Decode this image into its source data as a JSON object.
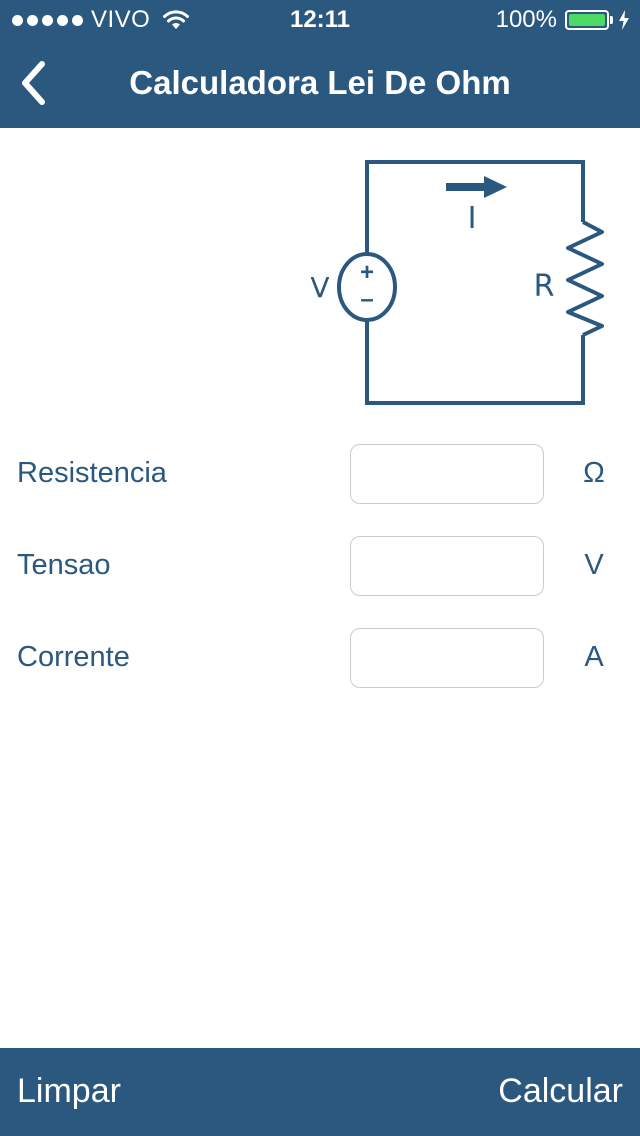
{
  "status_bar": {
    "carrier": "VIVO",
    "time": "12:11",
    "battery_percent": "100%",
    "battery_level": 1.0,
    "signal_bars": 5,
    "icons": [
      "signal-dots-icon",
      "wifi-icon",
      "battery-icon",
      "charging-bolt-icon"
    ]
  },
  "nav": {
    "title": "Calculadora Lei De Ohm",
    "back_icon": "chevron-left-icon"
  },
  "diagram": {
    "voltage_label": "V",
    "current_label": "I",
    "resistance_label": "R",
    "plus_sign": "+",
    "minus_sign": "–"
  },
  "form": {
    "rows": [
      {
        "label": "Resistencia",
        "value": "",
        "unit": "Ω"
      },
      {
        "label": "Tensao",
        "value": "",
        "unit": "V"
      },
      {
        "label": "Corrente",
        "value": "",
        "unit": "A"
      }
    ]
  },
  "toolbar": {
    "clear_label": "Limpar",
    "calculate_label": "Calcular"
  },
  "colors": {
    "primary": "#2b587f",
    "background": "#ffffff",
    "battery_fill": "#4cd964",
    "input_border": "#cccccc"
  }
}
